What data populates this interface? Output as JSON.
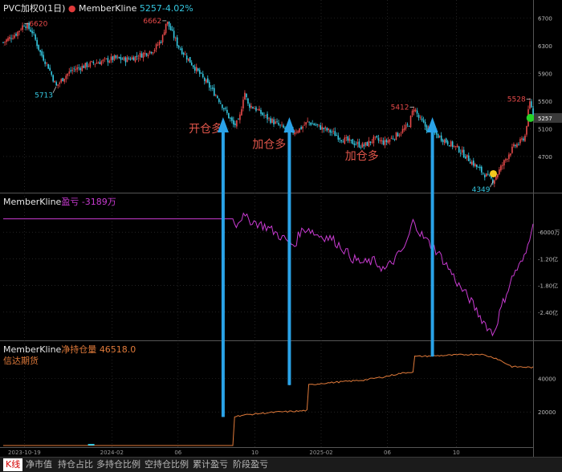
{
  "header": {
    "main_title": "PVC加权0(1日)",
    "main_indicator": "MemberKline",
    "main_value": "5257",
    "main_change": "-4.02%",
    "pnl_indicator": "MemberKline",
    "pnl_label": "盈亏",
    "pnl_value": "-3189万",
    "pos_indicator": "MemberKline",
    "pos_label": "净持仓量",
    "pos_value": "46518.0",
    "broker": "信达期货"
  },
  "tabs": [
    "K线",
    "净市值",
    "持仓占比",
    "多持仓比例",
    "空持仓比例",
    "累计盈亏",
    "阶段盈亏"
  ],
  "active_tab": "K线",
  "colors": {
    "up": "#e84a4a",
    "down": "#35c7e0",
    "pnl": "#c93bd2",
    "position": "#e07a3a",
    "arrow": "#2aa3e8",
    "annotation": "#e0554a",
    "grid": "#3a3a3a"
  },
  "chart_data": [
    {
      "type": "candlestick",
      "name": "PVC加权0(1日)",
      "x_ticks": [
        "2023-10-19",
        "2024-02",
        "06",
        "10",
        "2025-02",
        "06",
        "10"
      ],
      "y_ticks": [
        4700,
        5100,
        5500,
        5900,
        6300,
        6700
      ],
      "y_tick_labels": [
        "4700",
        "5100",
        "5500",
        "5900",
        "6300",
        "6700"
      ],
      "ylim": [
        4200,
        6800
      ],
      "current_value": 5257,
      "current_label": "5257",
      "close_path": [
        [
          0,
          6350
        ],
        [
          0.025,
          6480
        ],
        [
          0.04,
          6620
        ],
        [
          0.055,
          6500
        ],
        [
          0.07,
          6200
        ],
        [
          0.085,
          6000
        ],
        [
          0.1,
          5713
        ],
        [
          0.115,
          5850
        ],
        [
          0.13,
          5950
        ],
        [
          0.15,
          6000
        ],
        [
          0.17,
          6050
        ],
        [
          0.19,
          6080
        ],
        [
          0.21,
          6120
        ],
        [
          0.23,
          6100
        ],
        [
          0.25,
          6140
        ],
        [
          0.27,
          6200
        ],
        [
          0.285,
          6250
        ],
        [
          0.3,
          6400
        ],
        [
          0.308,
          6662
        ],
        [
          0.315,
          6550
        ],
        [
          0.33,
          6300
        ],
        [
          0.35,
          6100
        ],
        [
          0.37,
          5900
        ],
        [
          0.39,
          5700
        ],
        [
          0.405,
          5550
        ],
        [
          0.42,
          5350
        ],
        [
          0.435,
          5150
        ],
        [
          0.445,
          5200
        ],
        [
          0.455,
          5650
        ],
        [
          0.462,
          5450
        ],
        [
          0.475,
          5400
        ],
        [
          0.49,
          5300
        ],
        [
          0.51,
          5200
        ],
        [
          0.53,
          5100
        ],
        [
          0.545,
          5050
        ],
        [
          0.56,
          5100
        ],
        [
          0.575,
          5200
        ],
        [
          0.59,
          5150
        ],
        [
          0.605,
          5100
        ],
        [
          0.62,
          5050
        ],
        [
          0.64,
          4950
        ],
        [
          0.66,
          4900
        ],
        [
          0.68,
          4850
        ],
        [
          0.7,
          4950
        ],
        [
          0.72,
          4900
        ],
        [
          0.74,
          5000
        ],
        [
          0.75,
          5050
        ],
        [
          0.765,
          5150
        ],
        [
          0.775,
          5412
        ],
        [
          0.785,
          5250
        ],
        [
          0.8,
          5100
        ],
        [
          0.82,
          5000
        ],
        [
          0.84,
          4900
        ],
        [
          0.86,
          4800
        ],
        [
          0.88,
          4650
        ],
        [
          0.9,
          4500
        ],
        [
          0.915,
          4400
        ],
        [
          0.925,
          4349
        ],
        [
          0.94,
          4550
        ],
        [
          0.955,
          4750
        ],
        [
          0.965,
          4850
        ],
        [
          0.975,
          4900
        ],
        [
          0.985,
          5000
        ],
        [
          0.99,
          5300
        ],
        [
          0.995,
          5528
        ],
        [
          1.0,
          5257
        ]
      ],
      "annotations": [
        {
          "text": "6620",
          "x": 0.04,
          "y": 6620,
          "color": "#e84a4a",
          "pos": "right"
        },
        {
          "text": "5713",
          "x": 0.1,
          "y": 5713,
          "color": "#35c7e0",
          "pos": "left-below"
        },
        {
          "text": "6662",
          "x": 0.308,
          "y": 6662,
          "color": "#e84a4a",
          "pos": "left"
        },
        {
          "text": "5412",
          "x": 0.775,
          "y": 5412,
          "color": "#e84a4a",
          "pos": "left"
        },
        {
          "text": "4349",
          "x": 0.925,
          "y": 4349,
          "color": "#35c7e0",
          "pos": "left-below"
        },
        {
          "text": "5528",
          "x": 0.995,
          "y": 5528,
          "color": "#e84a4a",
          "pos": "left"
        },
        {
          "text": "开仓多",
          "x": 0.435,
          "y": 5050,
          "color": "#e0554a",
          "pos": "callout"
        },
        {
          "text": "加仓多",
          "x": 0.555,
          "y": 4820,
          "color": "#e0554a",
          "pos": "callout"
        },
        {
          "text": "加仓多",
          "x": 0.73,
          "y": 4650,
          "color": "#e0554a",
          "pos": "callout"
        }
      ]
    },
    {
      "type": "line",
      "name": "盈亏",
      "unit": "万",
      "y_ticks": [
        -6000,
        -12000,
        -18000,
        -24000
      ],
      "y_tick_labels": [
        "-6000万",
        "-1.20亿",
        "-1.80亿",
        "-2.40亿"
      ],
      "ylim": [
        -30000,
        0
      ],
      "current_value": -3189,
      "path": [
        [
          0,
          -3000
        ],
        [
          0.435,
          -3000
        ],
        [
          0.44,
          -4200
        ],
        [
          0.45,
          -2500
        ],
        [
          0.47,
          -3500
        ],
        [
          0.5,
          -5000
        ],
        [
          0.53,
          -7500
        ],
        [
          0.55,
          -9000
        ],
        [
          0.56,
          -6000
        ],
        [
          0.575,
          -5000
        ],
        [
          0.59,
          -6500
        ],
        [
          0.62,
          -7500
        ],
        [
          0.64,
          -9500
        ],
        [
          0.66,
          -12000
        ],
        [
          0.68,
          -13000
        ],
        [
          0.7,
          -12500
        ],
        [
          0.72,
          -14500
        ],
        [
          0.74,
          -12000
        ],
        [
          0.76,
          -9000
        ],
        [
          0.775,
          -3000
        ],
        [
          0.785,
          -6000
        ],
        [
          0.8,
          -8000
        ],
        [
          0.82,
          -10500
        ],
        [
          0.84,
          -14000
        ],
        [
          0.86,
          -18000
        ],
        [
          0.88,
          -21000
        ],
        [
          0.9,
          -25000
        ],
        [
          0.915,
          -27500
        ],
        [
          0.925,
          -29000
        ],
        [
          0.94,
          -23000
        ],
        [
          0.955,
          -18000
        ],
        [
          0.965,
          -15000
        ],
        [
          0.975,
          -13500
        ],
        [
          0.985,
          -11500
        ],
        [
          0.99,
          -9000
        ],
        [
          1.0,
          -3189
        ]
      ]
    },
    {
      "type": "line",
      "name": "净持仓量",
      "y_ticks": [
        20000,
        40000
      ],
      "y_tick_labels": [
        "20000",
        "40000"
      ],
      "ylim": [
        0,
        55000
      ],
      "current_value": 46518.0,
      "path": [
        [
          0,
          0
        ],
        [
          0.435,
          0
        ],
        [
          0.436,
          17000
        ],
        [
          0.45,
          18000
        ],
        [
          0.48,
          19000
        ],
        [
          0.52,
          20000
        ],
        [
          0.56,
          20500
        ],
        [
          0.575,
          21000
        ],
        [
          0.576,
          36000
        ],
        [
          0.6,
          37000
        ],
        [
          0.64,
          38000
        ],
        [
          0.68,
          39000
        ],
        [
          0.72,
          41000
        ],
        [
          0.75,
          43000
        ],
        [
          0.775,
          44000
        ],
        [
          0.776,
          53000
        ],
        [
          0.82,
          53500
        ],
        [
          0.86,
          54000
        ],
        [
          0.9,
          54500
        ],
        [
          0.93,
          52000
        ],
        [
          0.96,
          47000
        ],
        [
          1.0,
          46518
        ]
      ]
    }
  ]
}
